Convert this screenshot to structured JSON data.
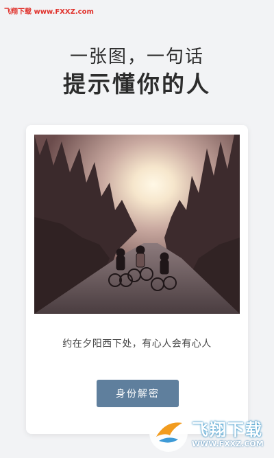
{
  "watermark_top": "飞翔下载 www.FXXZ.com",
  "headline": {
    "line1": "一张图，一句话",
    "line2": "提示懂你的人"
  },
  "card": {
    "image_alt": "three cyclists riding on a forest road at sunset",
    "caption": "约在夕阳西下处，有心人会有心人",
    "button_label": "身份解密"
  },
  "logo_watermark": {
    "text": "飞翔下载",
    "url": "WWW.FXXZ.COM"
  },
  "colors": {
    "background": "#f2f3f5",
    "card": "#ffffff",
    "button": "#5f7f9d",
    "watermark_red": "#e0302a"
  }
}
